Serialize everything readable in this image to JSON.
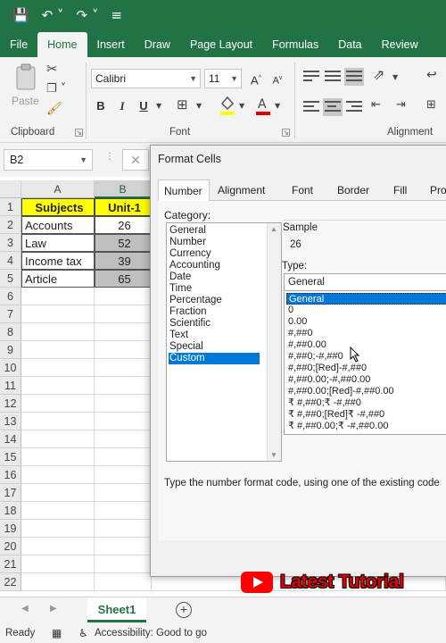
{
  "ribbon_tabs": [
    "File",
    "Home",
    "Insert",
    "Draw",
    "Page Layout",
    "Formulas",
    "Data",
    "Review"
  ],
  "ribbon": {
    "paste_label": "Paste",
    "font_name": "Calibri",
    "font_size": "11",
    "bold": "B",
    "italic": "I",
    "underline": "U",
    "grow_font": "A",
    "shrink_font": "A",
    "clipboard_label": "Clipboard",
    "font_label": "Font",
    "alignment_label": "Alignment"
  },
  "formula_bar": {
    "name_box": "B2"
  },
  "columns": [
    "A",
    "B"
  ],
  "rows": [
    "1",
    "2",
    "3",
    "4",
    "5",
    "6",
    "7",
    "8",
    "9",
    "10",
    "11",
    "12",
    "13",
    "14",
    "15",
    "16",
    "17",
    "18",
    "19",
    "20",
    "21",
    "22"
  ],
  "table": {
    "headers": [
      "Subjects",
      "Unit-1"
    ],
    "rows": [
      [
        "Accounts",
        "26"
      ],
      [
        "Law",
        "52"
      ],
      [
        "Income tax",
        "39"
      ],
      [
        "Article",
        "65"
      ]
    ]
  },
  "sheet_tab": "Sheet1",
  "status": {
    "ready": "Ready",
    "accessibility": "Accessibility: Good to go"
  },
  "dialog": {
    "title": "Format Cells",
    "tabs": [
      "Number",
      "Alignment",
      "Font",
      "Border",
      "Fill",
      "Prote"
    ],
    "category_label": "Category:",
    "categories": [
      "General",
      "Number",
      "Currency",
      "Accounting",
      "Date",
      "Time",
      "Percentage",
      "Fraction",
      "Scientific",
      "Text",
      "Special",
      "Custom"
    ],
    "selected_category": "Custom",
    "sample_label": "Sample",
    "sample_value": "26",
    "type_label": "Type:",
    "type_value": "General",
    "types": [
      "General",
      "0",
      "0.00",
      "#,##0",
      "#,##0.00",
      "#,##0;-#,##0",
      "#,##0;[Red]-#,##0",
      "#,##0.00;-#,##0.00",
      "#,##0.00;[Red]-#,##0.00",
      "₹ #,##0;₹ -#,##0",
      "₹ #,##0;[Red]₹ -#,##0",
      "₹ #,##0.00;₹ -#,##0.00"
    ],
    "hint": "Type the number format code, using one of the existing code"
  },
  "watermark": "Latest Tutorial",
  "colors": {
    "excel_green": "#217346",
    "header_yellow": "#ffff00",
    "selection_blue": "#0078d7"
  }
}
